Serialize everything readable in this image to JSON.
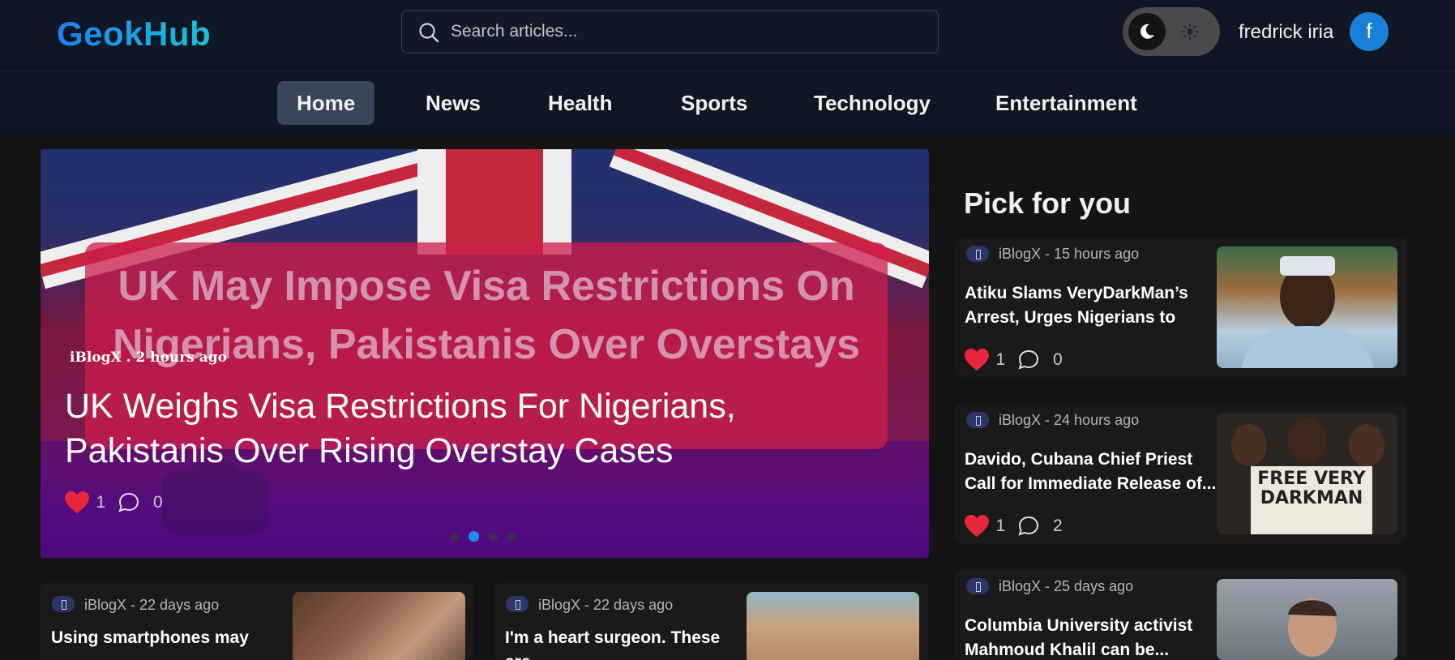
{
  "header": {
    "logo": "GeokHub",
    "search_placeholder": "Search articles...",
    "username": "fredrick iria",
    "avatar_initial": "f"
  },
  "nav": {
    "items": [
      {
        "label": "Home",
        "active": true
      },
      {
        "label": "News"
      },
      {
        "label": "Health"
      },
      {
        "label": "Sports"
      },
      {
        "label": "Technology"
      },
      {
        "label": "Entertainment"
      }
    ]
  },
  "hero": {
    "image_text": "UK May Impose Visa Restrictions On Nigerians, Pakistanis Over Overstays",
    "meta": "iBlogX . 2 hours ago",
    "title": "UK Weighs Visa Restrictions For Nigerians, Pakistanis Over Rising Overstay Cases",
    "likes": "1",
    "comments": "0",
    "active_slide": 2,
    "slide_count": 4
  },
  "articles": [
    {
      "source": "iBlogX - 22 days ago",
      "title": "Using smartphones may"
    },
    {
      "source": "iBlogX - 22 days ago",
      "title": "I'm a heart surgeon. These are"
    }
  ],
  "sidebar": {
    "title": "Pick for you",
    "items": [
      {
        "source": "iBlogX - 15 hours ago",
        "title": "Atiku Slams VeryDarkMan’s Arrest, Urges Nigerians to Stan...",
        "likes": "1",
        "comments": "0"
      },
      {
        "source": "iBlogX - 24 hours ago",
        "title": "Davido, Cubana Chief Priest Call for Immediate Release of...",
        "likes": "1",
        "comments": "2",
        "thumb_text": "FREE VERY DARKMAN"
      },
      {
        "source": "iBlogX - 25 days ago",
        "title": "Columbia University activist Mahmoud Khalil can be..."
      }
    ]
  },
  "colors": {
    "background": "#141414",
    "header": "#0f1624",
    "accent": "#1a7fd8",
    "like": "#e8263c"
  }
}
